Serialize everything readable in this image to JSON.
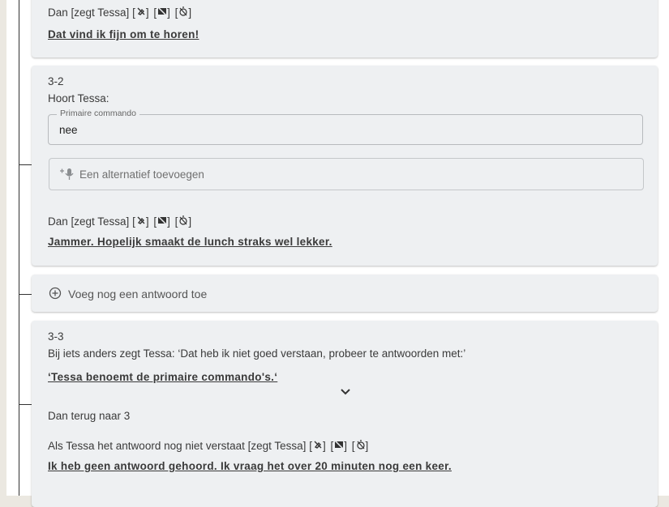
{
  "card_top": {
    "then_line": "Dan [zegt Tessa]",
    "icons": "[🔇] [🚫] [⏱]",
    "response": "Dat vind ik fijn om te horen!"
  },
  "card_3_2": {
    "number": "3-2",
    "heard_label": "Hoort Tessa:",
    "primary_legend": "Primaire commando",
    "primary_value": "nee",
    "alt_placeholder": "Een alternatief toevoegen",
    "then_line": "Dan [zegt Tessa]",
    "icons": "[🔇] [🚫] [⏱]",
    "response": "Jammer. Hopelijk smaakt de lunch straks wel lekker."
  },
  "add_answer": {
    "label": "Voeg nog een antwoord toe"
  },
  "card_3_3": {
    "number": "3-3",
    "else_line": "Bij iets anders zegt Tessa: ‘Dat heb ik niet goed verstaan, probeer te antwoorden met:’",
    "primary_note": "‘Tessa benoemt de primaire commando's.‘",
    "back_to": "Dan terug naar  3",
    "not_understood_line": "Als Tessa het antwoord nog niet verstaat [zegt Tessa]",
    "icons": "[🔇] [🚫] [⏱]",
    "final_response": "Ik heb geen antwoord gehoord. Ik vraag het over 20 minuten nog een keer."
  }
}
